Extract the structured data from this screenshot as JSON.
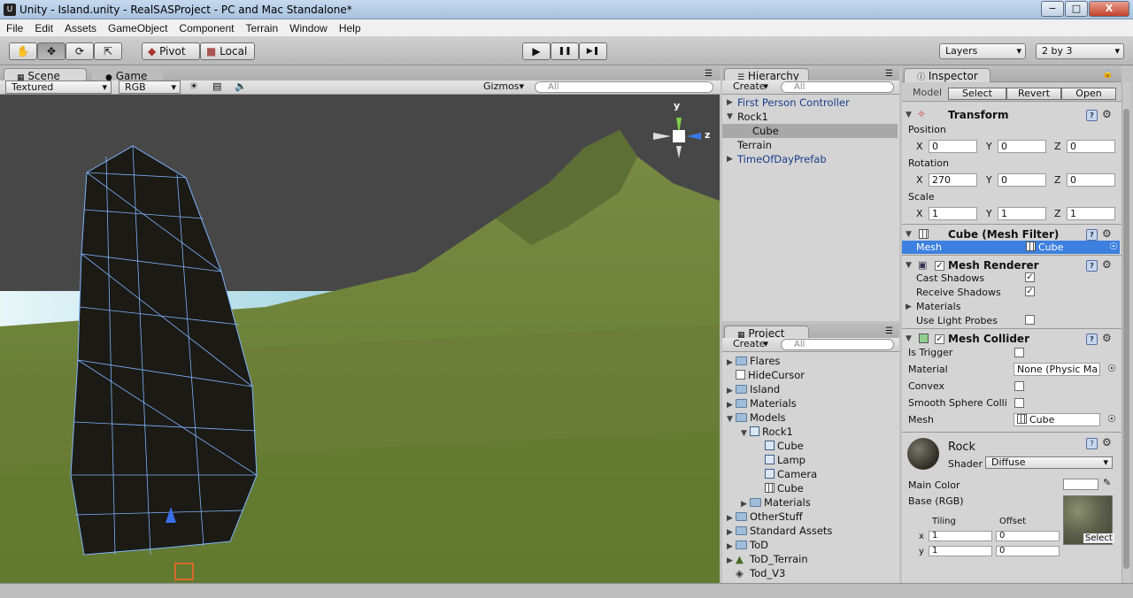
{
  "window": {
    "title": "Unity - Island.unity - RealSASProject - PC and Mac Standalone*",
    "min": "−",
    "max": "□",
    "close": "X"
  },
  "menu": [
    "File",
    "Edit",
    "Assets",
    "GameObject",
    "Component",
    "Terrain",
    "Window",
    "Help"
  ],
  "toolbar": {
    "pivot": "Pivot",
    "local": "Local",
    "play": "▶",
    "pause": "❚❚",
    "step": "▶❚",
    "layers": "Layers",
    "layout": "2 by 3"
  },
  "scene": {
    "tab": "Scene",
    "game_tab": "Game",
    "mode": "Textured",
    "color": "RGB",
    "gizmos": "Gizmos",
    "search": "All",
    "axis_y": "y",
    "axis_z": "z"
  },
  "hierarchy": {
    "tab": "Hierarchy",
    "create": "Create",
    "search": "All",
    "items": [
      {
        "label": "First Person Controller",
        "tri": "▶"
      },
      {
        "label": "Rock1",
        "tri": "▼"
      },
      {
        "label": "Cube",
        "tri": ""
      },
      {
        "label": "Terrain",
        "tri": ""
      },
      {
        "label": "TimeOfDayPrefab",
        "tri": "▶"
      }
    ]
  },
  "project": {
    "tab": "Project",
    "create": "Create",
    "search": "All",
    "items": [
      {
        "label": "Flares",
        "tri": "▶",
        "icon": "folder"
      },
      {
        "label": "HideCursor",
        "tri": "",
        "icon": "script"
      },
      {
        "label": "Island",
        "tri": "▶",
        "icon": "folder"
      },
      {
        "label": "Materials",
        "tri": "▶",
        "icon": "folder"
      },
      {
        "label": "Models",
        "tri": "▼",
        "icon": "folder"
      },
      {
        "label": "Rock1",
        "tri": "▼",
        "icon": "model"
      },
      {
        "label": "Cube",
        "tri": "",
        "icon": "model"
      },
      {
        "label": "Lamp",
        "tri": "",
        "icon": "model"
      },
      {
        "label": "Camera",
        "tri": "",
        "icon": "model"
      },
      {
        "label": "Cube",
        "tri": "",
        "icon": "mesh"
      },
      {
        "label": "Materials",
        "tri": "▶",
        "icon": "folder"
      },
      {
        "label": "OtherStuff",
        "tri": "▶",
        "icon": "folder"
      },
      {
        "label": "Standard Assets",
        "tri": "▶",
        "icon": "folder"
      },
      {
        "label": "ToD",
        "tri": "▶",
        "icon": "folder"
      },
      {
        "label": "ToD_Terrain",
        "tri": "▶",
        "icon": "terrain"
      },
      {
        "label": "Tod_V3",
        "tri": "",
        "icon": "scene"
      }
    ]
  },
  "inspector": {
    "tab": "Inspector",
    "model": "Model",
    "select": "Select",
    "revert": "Revert",
    "open": "Open",
    "transform": {
      "title": "Transform",
      "position": "Position",
      "rotation": "Rotation",
      "scale": "Scale",
      "x": "X",
      "y": "Y",
      "z": "Z",
      "pos": [
        "0",
        "0",
        "0"
      ],
      "rot": [
        "270",
        "0",
        "0"
      ],
      "scl": [
        "1",
        "1",
        "1"
      ]
    },
    "mesh_filter": {
      "title": "Cube (Mesh Filter)",
      "mesh_label": "Mesh",
      "mesh_value": "Cube"
    },
    "mesh_renderer": {
      "title": "Mesh Renderer",
      "cast": "Cast Shadows",
      "receive": "Receive Shadows",
      "materials": "Materials",
      "probes": "Use Light Probes"
    },
    "mesh_collider": {
      "title": "Mesh Collider",
      "trigger": "Is Trigger",
      "material": "Material",
      "material_value": "None (Physic Ma",
      "convex": "Convex",
      "smooth": "Smooth Sphere Colli",
      "mesh": "Mesh",
      "mesh_value": "Cube"
    },
    "material": {
      "name": "Rock",
      "shader_label": "Shader",
      "shader": "Diffuse",
      "main_color": "Main Color",
      "base": "Base (RGB)",
      "tiling": "Tiling",
      "offset": "Offset",
      "x": "x",
      "y": "y",
      "tx": "1",
      "ty": "1",
      "ox": "0",
      "oy": "0",
      "select": "Select"
    }
  },
  "colors": {
    "sky": "#4a4a4a",
    "terrain": "#6f7e3c",
    "selection": "#3d80df",
    "rock": "#1c1c16"
  }
}
